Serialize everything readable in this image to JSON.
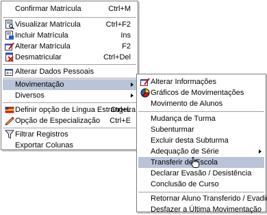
{
  "main_menu": {
    "items": [
      {
        "label": "Confirmar Matrícula",
        "shortcut": "Ctrl+M",
        "icon": null
      },
      {
        "label": "Visualizar Matrícula",
        "shortcut": "Ctrl+F2",
        "icon": "view-document-icon"
      },
      {
        "label": "Incluir Matrícula",
        "shortcut": "Ins",
        "icon": "add-document-icon"
      },
      {
        "label": "Alterar Matrícula",
        "shortcut": "F2",
        "icon": "edit-document-icon"
      },
      {
        "label": "Desmatricular",
        "shortcut": "Ctrl+Del",
        "icon": "remove-document-icon"
      },
      {
        "label": "Alterar Dados Pessoais",
        "shortcut": "",
        "icon": "edit-personal-data-icon"
      },
      {
        "label": "Movimentação",
        "shortcut": "",
        "icon": null,
        "submenu": true,
        "highlighted": true
      },
      {
        "label": "Diversos",
        "shortcut": "",
        "icon": null,
        "submenu": true
      },
      {
        "label": "Definir opção de Língua Estrangeira",
        "shortcut": "Ctrl+L",
        "icon": "flag-icon"
      },
      {
        "label": "Opção de Especialização",
        "shortcut": "Ctrl+E",
        "icon": "pencil-icon"
      },
      {
        "label": "Filtrar Registros",
        "shortcut": "",
        "icon": "filter-icon"
      },
      {
        "label": "Exportar Colunas",
        "shortcut": "",
        "icon": null
      }
    ]
  },
  "sub_menu": {
    "items": [
      {
        "label": "Alterar Informações",
        "icon": "edit-info-icon"
      },
      {
        "label": "Gráficos de Movimentações",
        "icon": "pie-chart-icon"
      },
      {
        "label": "Movimento de Alunos",
        "icon": null
      },
      {
        "label": "Mudança de Turma",
        "icon": null
      },
      {
        "label": "Subenturmar",
        "icon": null
      },
      {
        "label": "Excluir desta Subturma",
        "icon": null
      },
      {
        "label": "Adequação de Série",
        "icon": null,
        "submenu": true
      },
      {
        "label": "Transferir de Escola",
        "icon": null,
        "highlighted": true
      },
      {
        "label": "Declarar Evasão / Desistência",
        "icon": null
      },
      {
        "label": "Conclusão de Curso",
        "icon": null
      },
      {
        "label": "Retornar Aluno Transferido / Evadido",
        "icon": null
      },
      {
        "label": "Desfazer a Última Movimentação",
        "icon": null
      }
    ]
  },
  "colors": {
    "highlight": "#b9c4d8",
    "border": "#7a7a7a"
  }
}
